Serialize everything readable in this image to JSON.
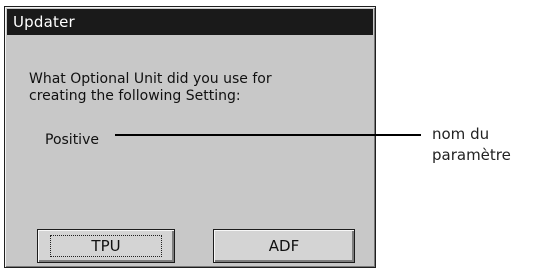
{
  "dialog": {
    "title": "Updater",
    "prompt_line1": "What Optional Unit did you use for",
    "prompt_line2": "creating the following Setting:",
    "setting_value": "Positive",
    "buttons": {
      "tpu": "TPU",
      "adf": "ADF"
    }
  },
  "annotation": {
    "line1": "nom du",
    "line2": "paramètre"
  }
}
